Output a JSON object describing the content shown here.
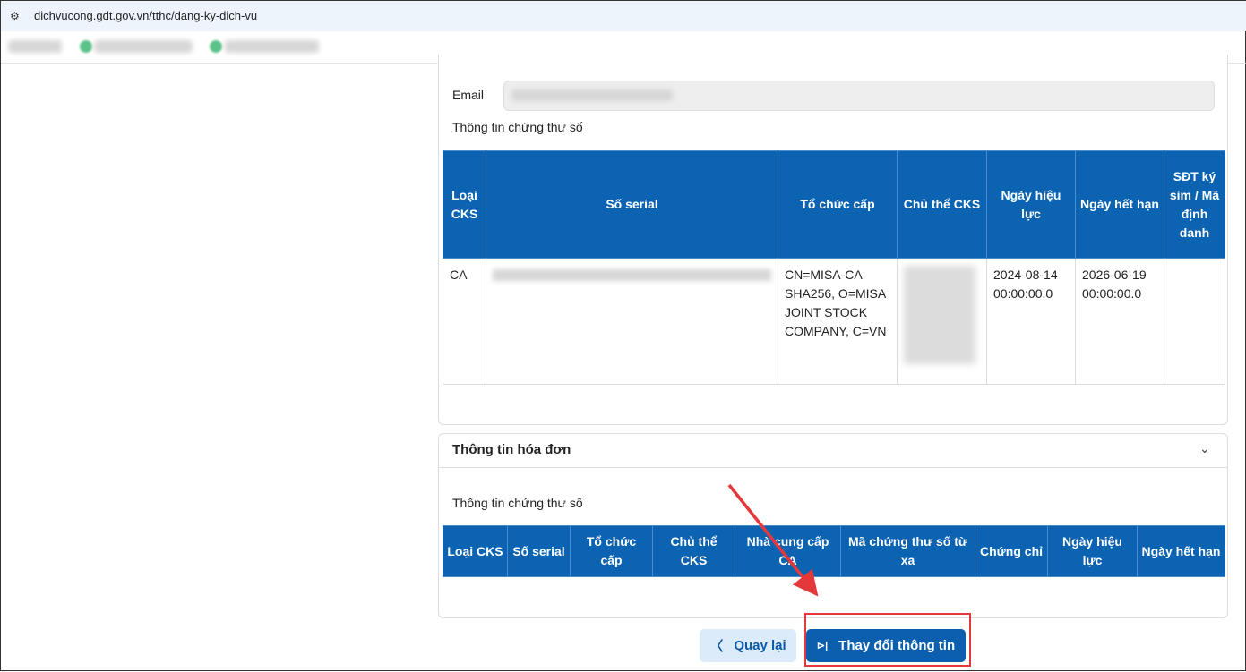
{
  "browser": {
    "url": "dichvucong.gdt.gov.vn/tthc/dang-ky-dich-vu"
  },
  "form": {
    "email_label": "Email",
    "cert_info_label": "Thông tin chứng thư số"
  },
  "cert_table": {
    "headers": [
      "Loại CKS",
      "Số serial",
      "Tổ chức cấp",
      "Chủ thể CKS",
      "Ngày hiệu lực",
      "Ngày hết hạn",
      "SĐT ký sim / Mã định danh"
    ],
    "rows": [
      {
        "type": "CA",
        "issuer": "CN=MISA-CA SHA256, O=MISA JOINT STOCK COMPANY, C=VN",
        "valid_from": "2024-08-14 00:00:00.0",
        "valid_to": "2026-06-19 00:00:00.0",
        "phone": ""
      }
    ]
  },
  "invoice_section": {
    "title": "Thông tin hóa đơn",
    "cert_info_label": "Thông tin chứng thư số",
    "headers": [
      "Loại CKS",
      "Số serial",
      "Tổ chức cấp",
      "Chủ thể CKS",
      "Nhà cung cấp CA",
      "Mã chứng thư số từ xa",
      "Chứng chỉ",
      "Ngày hiệu lực",
      "Ngày hết hạn"
    ]
  },
  "actions": {
    "back_label": "Quay lại",
    "change_label": "Thay đổi thông tin"
  },
  "colors": {
    "header_blue": "#0b63b2",
    "annotation_red": "#e5383b"
  }
}
